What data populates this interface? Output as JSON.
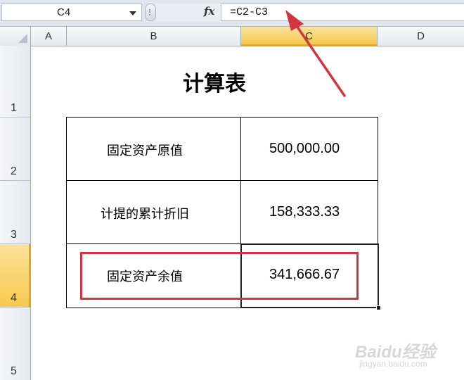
{
  "formula_bar": {
    "name_box": "C4",
    "fx_label": "fx",
    "formula": "=C2-C3"
  },
  "columns": [
    "A",
    "B",
    "C",
    "D"
  ],
  "selected_column": "C",
  "rows": [
    "1",
    "2",
    "3",
    "4",
    "5"
  ],
  "selected_row": "4",
  "sheet": {
    "title": "计算表",
    "table": [
      {
        "label": "固定资产原值",
        "value": "500,000.00"
      },
      {
        "label": "计提的累计折旧",
        "value": "158,333.33"
      },
      {
        "label": "固定资产余值",
        "value": "341,666.67"
      }
    ]
  },
  "annotation_color": "#d2353f",
  "watermark": {
    "main": "Baidu经验",
    "sub": "jingyan.baidu.com"
  }
}
